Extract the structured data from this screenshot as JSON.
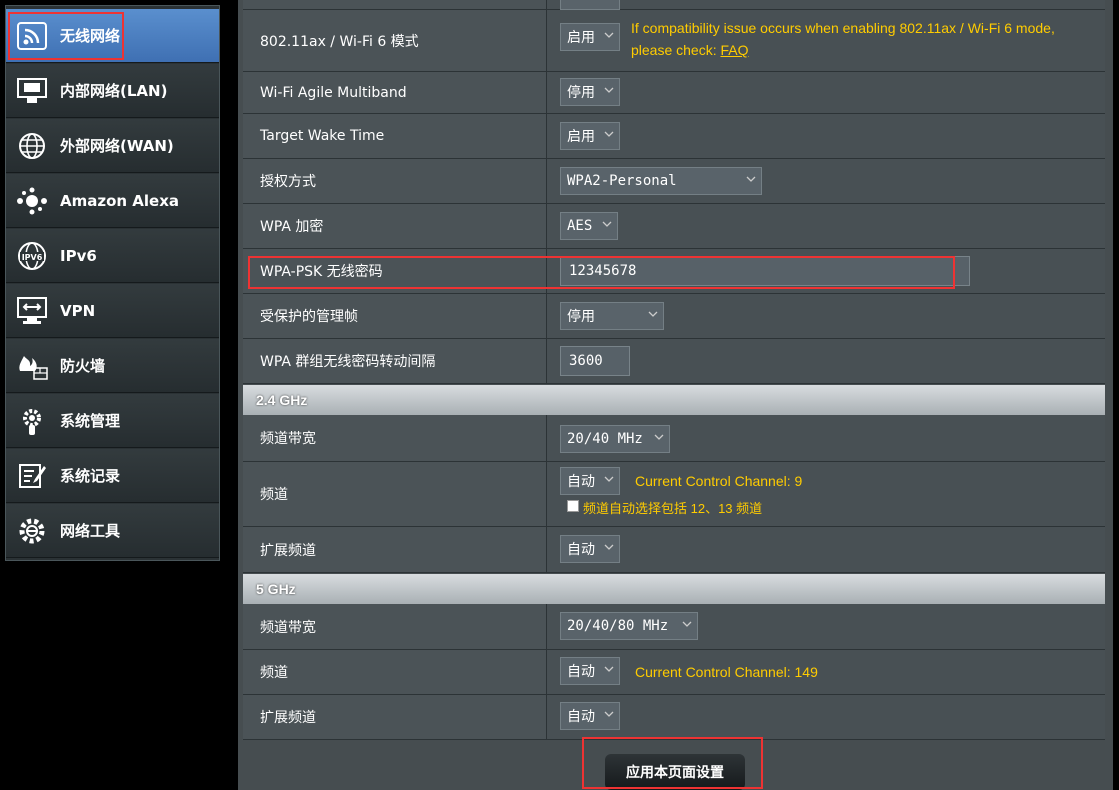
{
  "sidebar": {
    "items": [
      {
        "label": "无线网络",
        "icon": "wifi-icon",
        "active": true
      },
      {
        "label": "内部网络(LAN)",
        "icon": "lan-icon"
      },
      {
        "label": "外部网络(WAN)",
        "icon": "globe-icon"
      },
      {
        "label": "Amazon Alexa",
        "icon": "alexa-icon"
      },
      {
        "label": "IPv6",
        "icon": "ipv6-icon"
      },
      {
        "label": "VPN",
        "icon": "vpn-icon"
      },
      {
        "label": "防火墙",
        "icon": "firewall-icon"
      },
      {
        "label": "系统管理",
        "icon": "gear-icon"
      },
      {
        "label": "系统记录",
        "icon": "log-icon"
      },
      {
        "label": "网络工具",
        "icon": "tools-icon"
      }
    ]
  },
  "general": {
    "ax_label": "802.11ax / Wi-Fi 6 模式",
    "ax_value": "启用",
    "ax_note_1": "If compatibility issue occurs when enabling 802.11ax / Wi-Fi 6 mode,",
    "ax_note_2": "please check: ",
    "ax_note_link": "FAQ",
    "agile_label": "Wi-Fi Agile Multiband",
    "agile_value": "停用",
    "twt_label": "Target Wake Time",
    "twt_value": "启用",
    "auth_label": "授权方式",
    "auth_value": "WPA2-Personal",
    "enc_label": "WPA 加密",
    "enc_value": "AES",
    "psk_label": "WPA-PSK 无线密码",
    "psk_value": "12345678",
    "pmf_label": "受保护的管理帧",
    "pmf_value": "停用",
    "gk_label": "WPA 群组无线密码转动间隔",
    "gk_value": "3600"
  },
  "band24": {
    "title": "2.4 GHz",
    "bw_label": "频道带宽",
    "bw_value": "20/40 MHz",
    "ch_label": "频道",
    "ch_value": "自动",
    "ch_note": "Current Control Channel: 9",
    "ch_checkbox_label": "频道自动选择包括 12、13 频道",
    "ext_label": "扩展频道",
    "ext_value": "自动"
  },
  "band5": {
    "title": "5 GHz",
    "bw_label": "频道带宽",
    "bw_value": "20/40/80 MHz",
    "ch_label": "频道",
    "ch_value": "自动",
    "ch_note": "Current Control Channel: 149",
    "ext_label": "扩展频道",
    "ext_value": "自动"
  },
  "apply_label": "应用本页面设置",
  "colors": {
    "note": "#ffcc00",
    "highlight": "#e33333",
    "active": "#4a7fc0"
  }
}
